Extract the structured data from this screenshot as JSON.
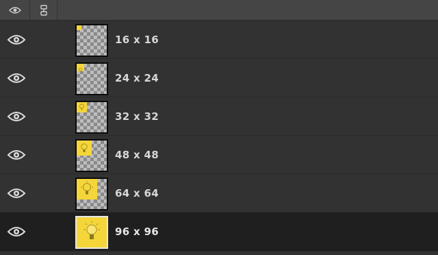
{
  "header": {
    "visibility_icon": "eye-icon",
    "link_icon": "link-icon"
  },
  "layers": [
    {
      "label": "16 x 16",
      "icon": "lightbulb-icon",
      "selected": false
    },
    {
      "label": "24 x 24",
      "icon": "lightbulb-icon",
      "selected": false
    },
    {
      "label": "32 x 32",
      "icon": "lightbulb-icon",
      "selected": false
    },
    {
      "label": "48 x 48",
      "icon": "lightbulb-icon",
      "selected": false
    },
    {
      "label": "64 x 64",
      "icon": "lightbulb-icon",
      "selected": false
    },
    {
      "label": "96 x 96",
      "icon": "lightbulb-icon",
      "selected": true
    }
  ],
  "colors": {
    "icon_yellow": "#f5d63a",
    "panel_bg": "#323232",
    "header_bg": "#454545",
    "selected_bg": "#1f1f1f"
  }
}
